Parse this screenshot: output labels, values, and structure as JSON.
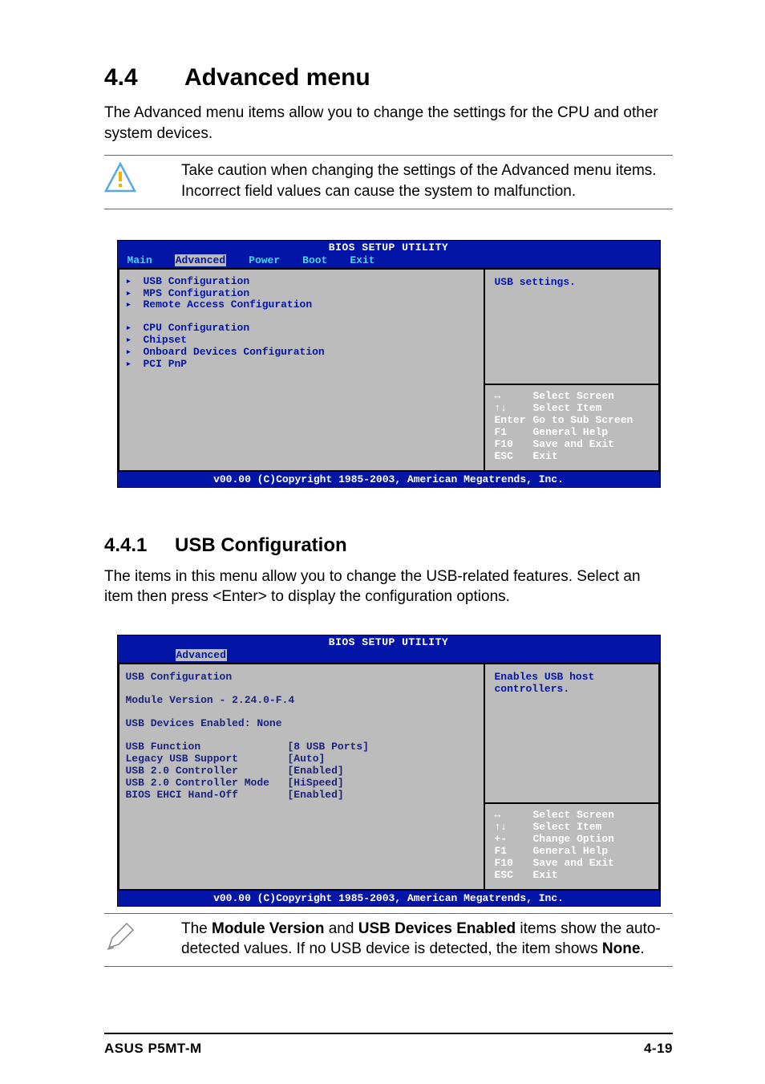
{
  "section": {
    "number": "4.4",
    "title": "Advanced menu",
    "intro": "The Advanced menu items allow you to change the settings for the CPU and other system devices."
  },
  "caution": {
    "text": "Take caution when changing the settings of the Advanced menu items. Incorrect field values can cause the system to malfunction."
  },
  "bios1": {
    "title": "BIOS SETUP UTILITY",
    "tabs": [
      "Main",
      "Advanced",
      "Power",
      "Boot",
      "Exit"
    ],
    "selected_tab": "Advanced",
    "items_a": [
      "USB Configuration",
      "MPS Configuration",
      "Remote Access Configuration"
    ],
    "items_b": [
      "CPU Configuration",
      "Chipset",
      "Onboard Devices Configuration",
      "PCI PnP"
    ],
    "help_top": "USB settings.",
    "help_keys": [
      {
        "k": "↔",
        "v": "Select Screen"
      },
      {
        "k": "↑↓",
        "v": "Select Item"
      },
      {
        "k": "Enter",
        "v": "Go to Sub Screen"
      },
      {
        "k": "F1",
        "v": "General Help"
      },
      {
        "k": "F10",
        "v": "Save and Exit"
      },
      {
        "k": "ESC",
        "v": "Exit"
      }
    ],
    "footer": "v00.00 (C)Copyright 1985-2003, American Megatrends, Inc."
  },
  "subsection": {
    "number": "4.4.1",
    "title": "USB Configuration",
    "intro": "The items in this menu allow you to change the USB-related features. Select an item then press <Enter> to display the configuration options."
  },
  "bios2": {
    "title": "BIOS SETUP UTILITY",
    "tab": "Advanced",
    "header": "USB Configuration",
    "module_line": "Module Version - 2.24.0-F.4",
    "devices_line": "USB Devices Enabled: None",
    "options": [
      {
        "label": "USB Function",
        "value": "[8 USB Ports]"
      },
      {
        "label": "Legacy USB Support",
        "value": "[Auto]"
      },
      {
        "label": "USB 2.0 Controller",
        "value": "[Enabled]"
      },
      {
        "label": "USB 2.0 Controller Mode",
        "value": "[HiSpeed]"
      },
      {
        "label": "BIOS EHCI Hand-Off",
        "value": "[Enabled]"
      }
    ],
    "help_top": "Enables USB host controllers.",
    "help_keys": [
      {
        "k": "↔",
        "v": "Select Screen"
      },
      {
        "k": "↑↓",
        "v": "Select Item"
      },
      {
        "k": "+-",
        "v": "Change Option"
      },
      {
        "k": "F1",
        "v": "General Help"
      },
      {
        "k": "F10",
        "v": "Save and Exit"
      },
      {
        "k": "ESC",
        "v": "Exit"
      }
    ],
    "footer": "v00.00 (C)Copyright 1985-2003, American Megatrends, Inc."
  },
  "note": {
    "pre": "The ",
    "b1": "Module Version",
    "mid1": " and ",
    "b2": "USB Devices Enabled",
    "mid2": " items show the auto-detected values. If no USB device is detected, the item shows ",
    "b3": "None",
    "post": "."
  },
  "footer": {
    "left": "ASUS P5MT-M",
    "right": "4-19"
  }
}
